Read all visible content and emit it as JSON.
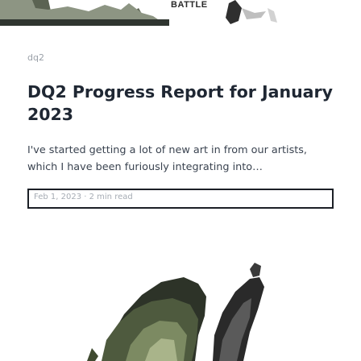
{
  "banner": {
    "caption": "BATTLE"
  },
  "card": {
    "tag": "dq2",
    "title": "DQ2 Progress Report for January 2023",
    "excerpt": "I've started getting a lot of new art in from our artists, which I have been furiously integrating into…",
    "meta": {
      "date": "Feb 1, 2023",
      "separator": "·",
      "read_time": "2 min read"
    }
  },
  "colors": {
    "title": "#1f2733",
    "text": "#3a4350",
    "muted": "#a6acb4",
    "border": "#1b1f26",
    "hero_sky": "#ffffff"
  },
  "icons": [
    "banner-art-image",
    "hero-art-image"
  ]
}
